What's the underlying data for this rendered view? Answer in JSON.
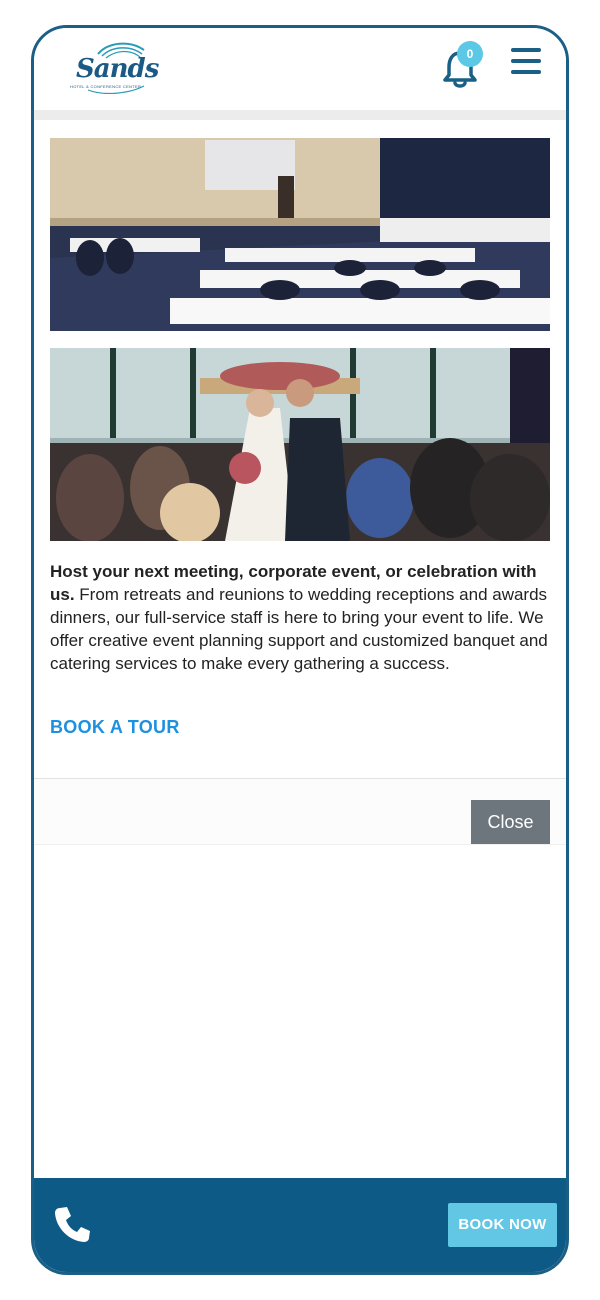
{
  "header": {
    "logo_word": "Sands",
    "logo_tagline": "HOTEL & CONFERENCE CENTER",
    "notification_count": "0"
  },
  "content": {
    "intro_bold": "Host your next meeting, corporate event, or celebration with us.",
    "intro_body": " From retreats and reunions to wedding receptions and awards dinners, our full-service staff is here to bring your event to life. We offer creative event planning support and customized banquet and catering services to make every gathering a success.",
    "tour_link": "BOOK A TOUR"
  },
  "dialog": {
    "close_label": "Close"
  },
  "footer": {
    "book_now_label": "BOOK NOW"
  },
  "colors": {
    "brand_navy": "#1a5f86",
    "footer_bg": "#0d5a86",
    "accent_cyan": "#5bc8e6",
    "link_blue": "#1e90e0",
    "close_gray": "#6d757d"
  },
  "icons": [
    "bell-icon",
    "hamburger-menu-icon",
    "phone-icon"
  ]
}
